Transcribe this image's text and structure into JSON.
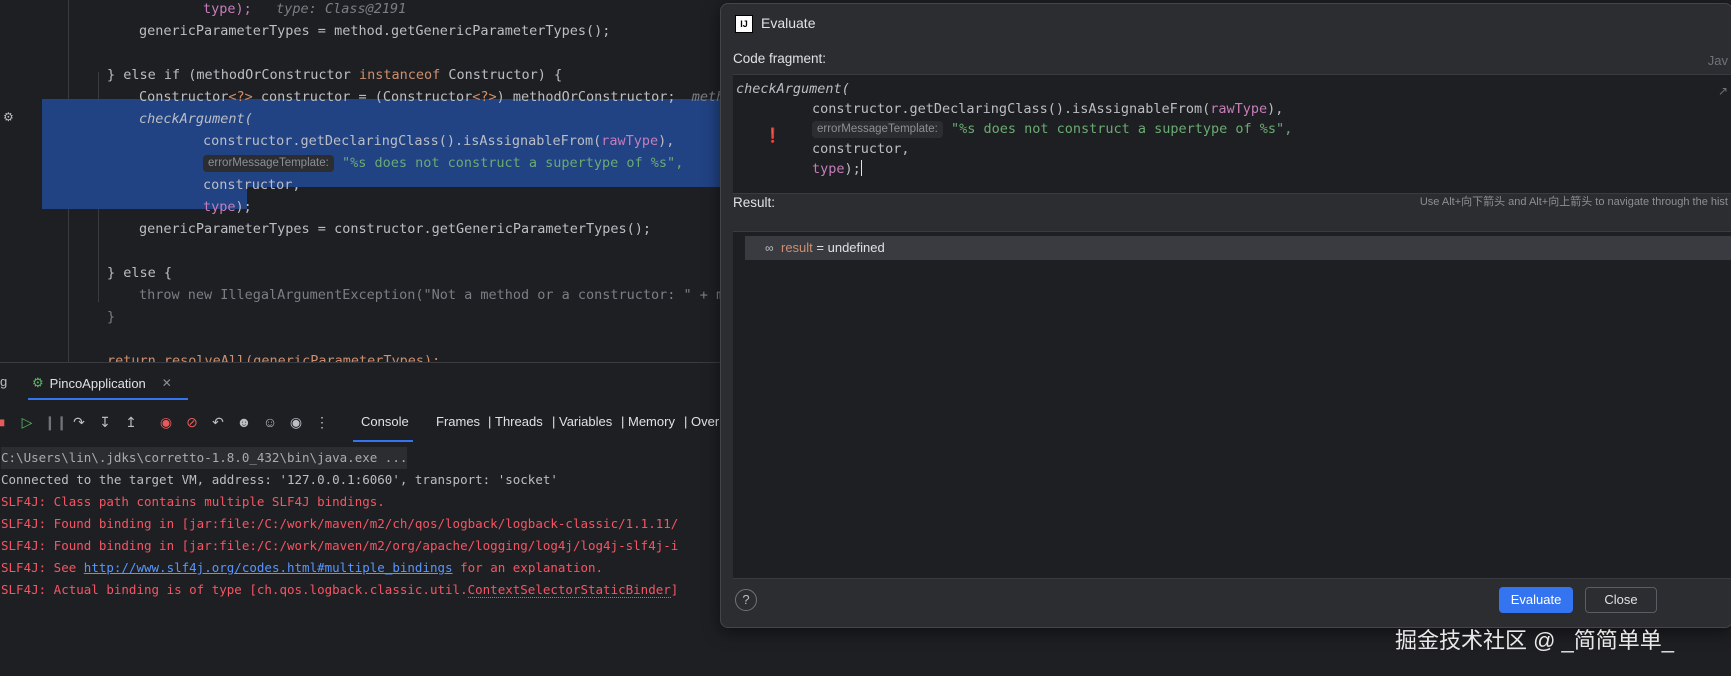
{
  "editor": {
    "lines": [
      {
        "code": "type);",
        "hint": "type: Class@2191"
      },
      {
        "code": "genericParameterTypes = method.getGenericParameterTypes();"
      },
      {
        "kw1": "} else if",
        "code1": " (methodOrConstructor ",
        "kw2": "instanceof",
        "code2": " Constructor) {"
      },
      {
        "code1": "Constructor",
        "gen1": "<?>",
        "code2": " constructor = (Constructor",
        "gen2": "<?>",
        "code3": ") methodOrConstructor;",
        "hint": "metho"
      },
      {
        "code": "checkArgument("
      },
      {
        "code1": "constructor.getDeclaringClass().isAssignableFrom(",
        "param": "rawType",
        "code2": "),"
      },
      {
        "hint": "errorMessageTemplate:",
        "str": "\"%s does not construct a supertype of %s\","
      },
      {
        "code": "constructor,"
      },
      {
        "param": "type",
        "code": ");"
      },
      {
        "code": "genericParameterTypes = constructor.getGenericParameterTypes();"
      },
      {
        "code": "} else {"
      },
      {
        "code": "throw new IllegalArgumentException(\"Not a method or a constructor: \" + me"
      },
      {
        "code": "}"
      },
      {
        "code": "return resolveAll(genericParameterTypes);"
      }
    ]
  },
  "debug": {
    "left_tab_fragment": "g",
    "app_tab": "PincoApplication",
    "subtabs": [
      "Console",
      "Frames",
      "|",
      "Threads",
      "|",
      "Variables",
      "|",
      "Memory",
      "|",
      "Over"
    ]
  },
  "console": {
    "lines": [
      "C:\\Users\\lin\\.jdks\\corretto-1.8.0_432\\bin\\java.exe ...",
      "Connected to the target VM, address: '127.0.0.1:6060', transport: 'socket'",
      "SLF4J: Class path contains multiple SLF4J bindings.",
      "SLF4J: Found binding in [jar:file:/C:/work/maven/m2/ch/qos/logback/logback-classic/1.1.11/",
      "SLF4J: Found binding in [jar:file:/C:/work/maven/m2/org/apache/logging/log4j/log4j-slf4j-i",
      {
        "prefix": "SLF4J: See ",
        "link": "http://www.slf4j.org/codes.html#multiple_bindings",
        "suffix": " for an explanation."
      },
      {
        "prefix": "SLF4J: Actual binding is of type [ch.qos.logback.classic.util.",
        "underlined": "ContextSelectorStaticBinder",
        "suffix": "]"
      }
    ]
  },
  "dialog": {
    "title": "Evaluate",
    "code_fragment_label": "Code fragment:",
    "language": "Jav",
    "code": {
      "line1": "checkArgument(",
      "line2_a": "constructor.getDeclaringClass().isAssignableFrom(",
      "line2_param": "rawType",
      "line2_b": "),",
      "line3_hint": "errorMessageTemplate:",
      "line3_str": "\"%s does not construct a supertype of %s\",",
      "line4": "constructor,",
      "line5_param": "type",
      "line5_b": ");"
    },
    "history_hint": "Use Alt+向下箭头 and Alt+向上箭头 to navigate through the hist",
    "result_label": "Result:",
    "result_name": "result",
    "result_value": " = undefined",
    "evaluate_button": "Evaluate",
    "close_button": "Close",
    "help": "?"
  },
  "watermark": "掘金技术社区 @ _简简单单_"
}
